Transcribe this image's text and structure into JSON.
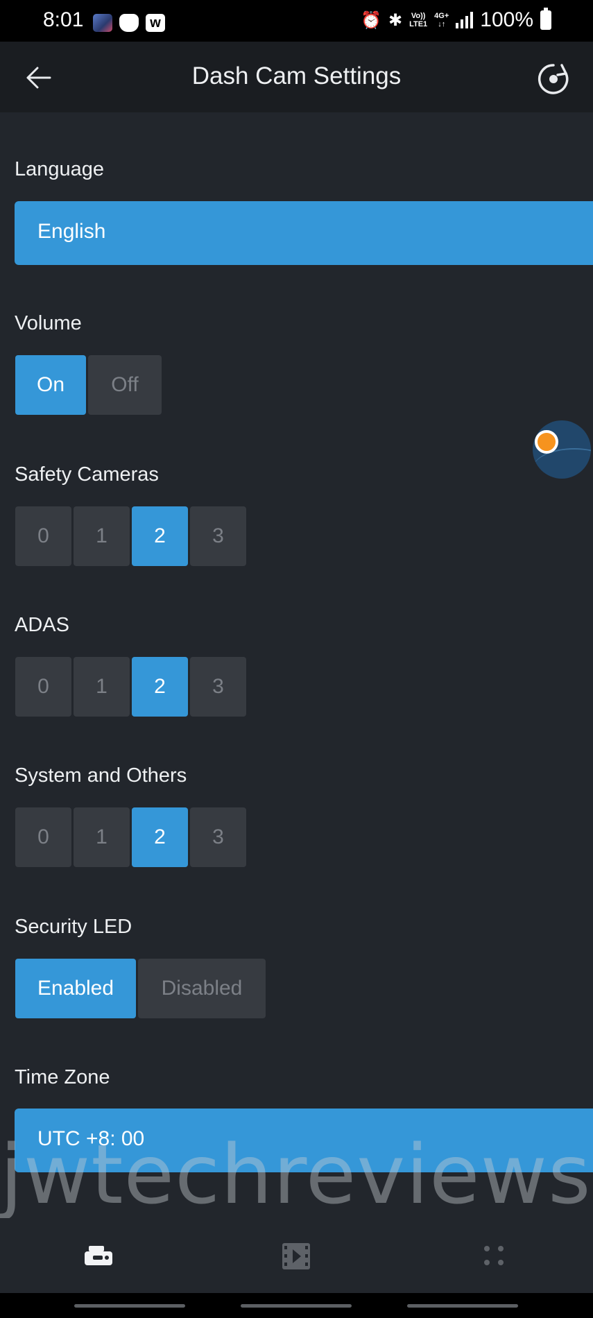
{
  "status_bar": {
    "time": "8:01",
    "battery": "100%",
    "network_top": "Vo))",
    "network_bottom": "LTE1",
    "data_top": "4G+",
    "data_bottom": "↓↑",
    "icons": [
      "app-icon",
      "cat-app-icon",
      "w-app-icon",
      "alarm-icon",
      "bluetooth-icon",
      "volte-icon",
      "4g-icon",
      "signal-icon",
      "battery-icon"
    ]
  },
  "header": {
    "title": "Dash Cam Settings",
    "back_icon": "back-arrow-icon",
    "reset_icon": "reset-icon"
  },
  "settings": {
    "language": {
      "label": "Language",
      "value": "English"
    },
    "volume": {
      "label": "Volume",
      "options": [
        "On",
        "Off"
      ],
      "selected": "On"
    },
    "safety_cameras": {
      "label": "Safety Cameras",
      "options": [
        "0",
        "1",
        "2",
        "3"
      ],
      "selected": "2"
    },
    "adas": {
      "label": "ADAS",
      "options": [
        "0",
        "1",
        "2",
        "3"
      ],
      "selected": "2"
    },
    "system_others": {
      "label": "System and Others",
      "options": [
        "0",
        "1",
        "2",
        "3"
      ],
      "selected": "2"
    },
    "security_led": {
      "label": "Security LED",
      "options": [
        "Enabled",
        "Disabled"
      ],
      "selected": "Enabled"
    },
    "time_zone": {
      "label": "Time Zone",
      "value": "UTC +8: 00"
    }
  },
  "watermark": "jwtechreviews.com",
  "bottom_nav": {
    "items": [
      "dashcam-icon",
      "video-icon",
      "more-icon"
    ],
    "active": "dashcam-icon"
  },
  "colors": {
    "accent": "#3597d8",
    "background": "#22262c",
    "header": "#1a1d21",
    "inactive_button": "#373b41",
    "bubble_dot": "#f6931e"
  }
}
